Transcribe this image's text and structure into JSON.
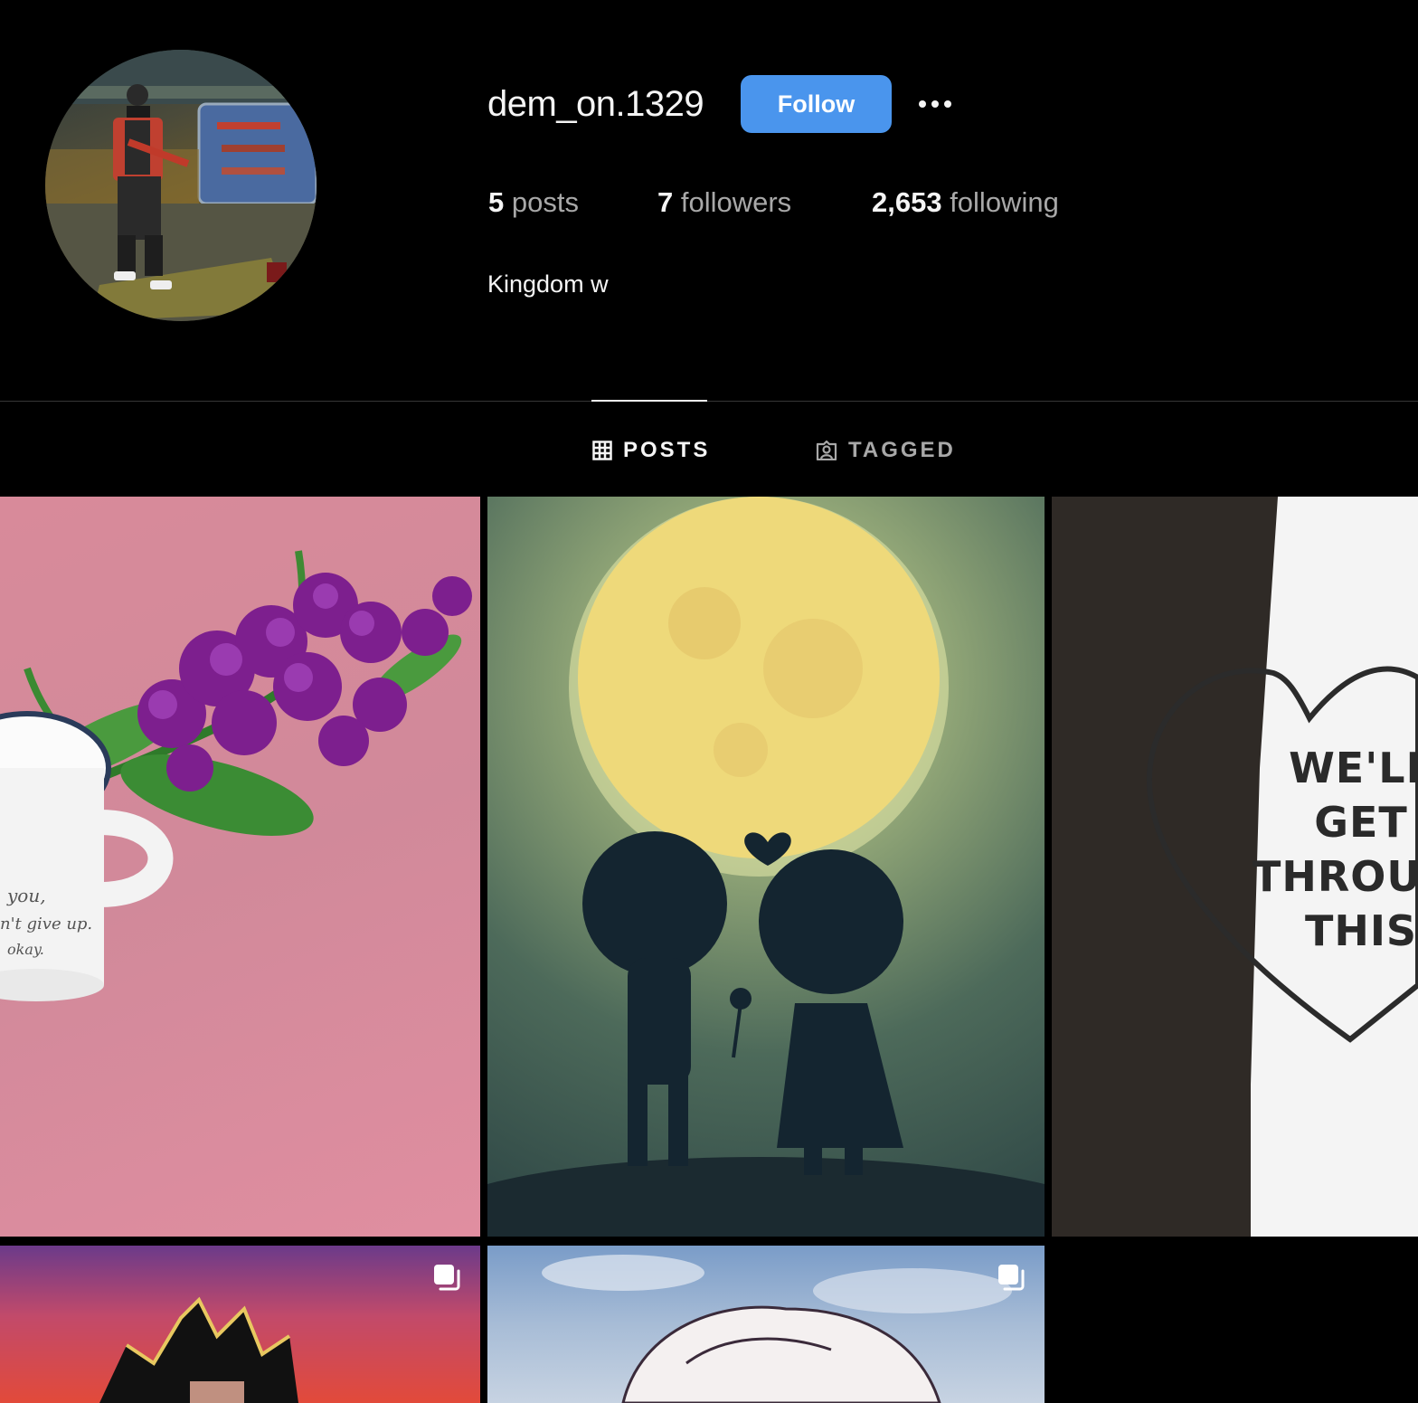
{
  "profile": {
    "username": "dem_on.1329",
    "follow_label": "Follow",
    "more_icon": "more-horizontal-icon",
    "bio": "Kingdom w",
    "accent_color": "#4a95ed"
  },
  "stats": {
    "posts_count": "5",
    "posts_label": " posts",
    "followers_count": "7",
    "followers_label": " followers",
    "following_count": "2,653",
    "following_label": " following"
  },
  "tabs": [
    {
      "label": "POSTS",
      "icon": "grid-icon",
      "active": true
    },
    {
      "label": "TAGGED",
      "icon": "tagged-user-icon",
      "active": false
    }
  ],
  "posts": [
    {
      "subject": "purple flowers in white mug on pink background",
      "mug_text": [
        "you,",
        "n't give up.",
        "okay."
      ],
      "multi": false
    },
    {
      "subject": "silhouette couple under full moon",
      "multi": false
    },
    {
      "subject": "heart drawing on white wall",
      "heart_text": [
        "WE'LL",
        "GET",
        "THROUGH",
        "THIS"
      ],
      "multi": false
    },
    {
      "subject": "anime character with spiky black hair",
      "multi": true
    },
    {
      "subject": "anime character with white hair",
      "multi": true
    }
  ]
}
